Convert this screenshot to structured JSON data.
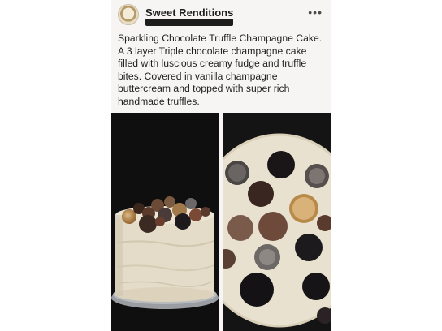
{
  "post": {
    "page_name": "Sweet Renditions",
    "more_icon": "more-dots-icon",
    "text": "Sparkling Chocolate Truffle Champagne Cake.  A 3 layer Triple chocolate champagne cake filled with luscious creamy fudge and truffle bites.  Covered in vanilla champagne buttercream and topped with super rich handmade truffles."
  },
  "photos": {
    "left": "cake-side-photo",
    "right": "cake-top-photo"
  },
  "colors": {
    "post_background": "#f7f5f3",
    "text": "#1f1f1f",
    "frosting": "#e6ddc8"
  }
}
